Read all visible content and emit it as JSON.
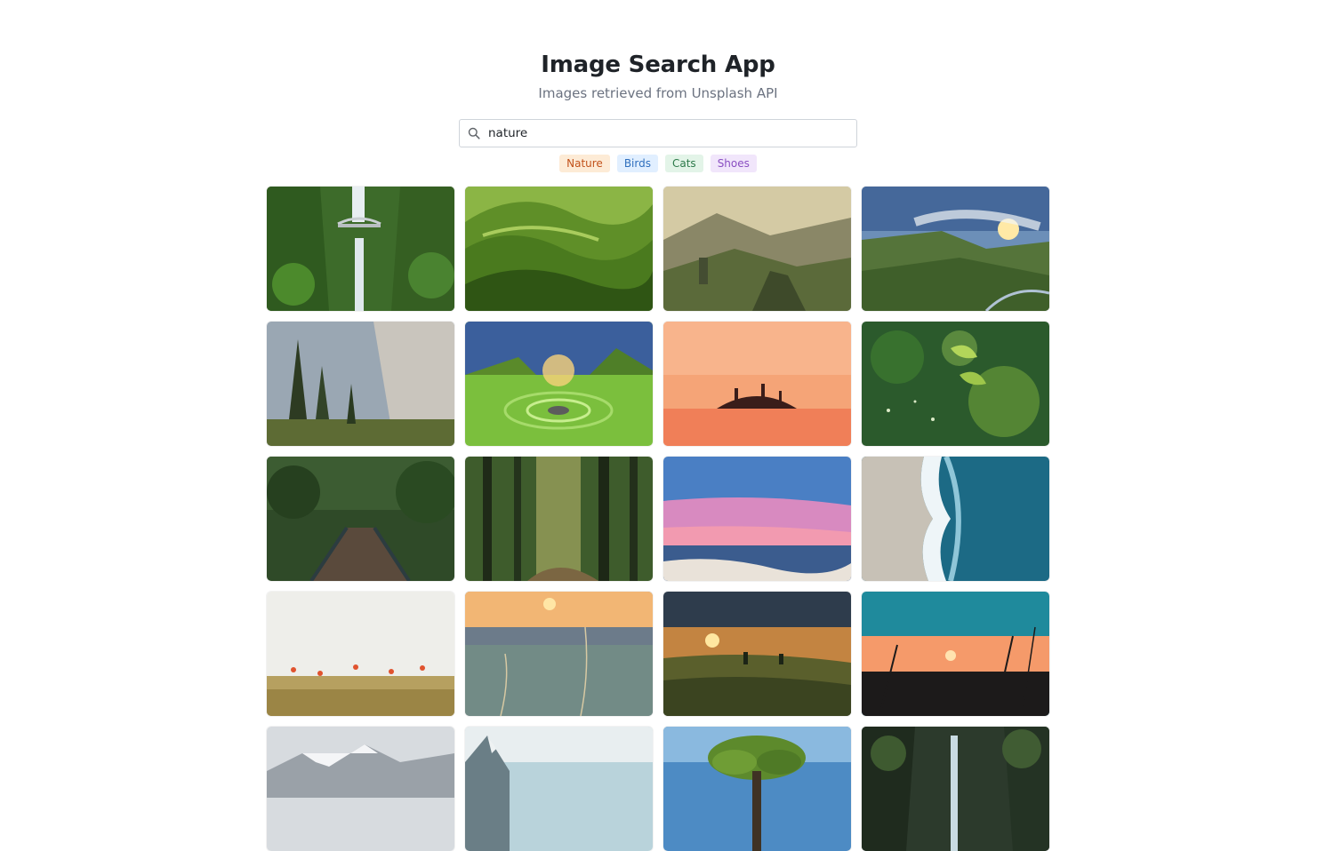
{
  "header": {
    "title": "Image Search App",
    "subtitle": "Images retrieved from Unsplash API"
  },
  "search": {
    "value": "nature",
    "icon": "search-icon"
  },
  "tags": [
    {
      "label": "Nature",
      "bg": "#fdebd6",
      "color": "#c2521b"
    },
    {
      "label": "Birds",
      "bg": "#e1efff",
      "color": "#2f6fbe"
    },
    {
      "label": "Cats",
      "bg": "#e3f4e8",
      "color": "#2d7a4a"
    },
    {
      "label": "Shoes",
      "bg": "#f1e6fb",
      "color": "#8a4fc2"
    }
  ],
  "results": [
    "waterfall-bridge",
    "green-hills",
    "misty-valley",
    "cliff-sunset",
    "granite-cliff-pines",
    "spiral-meadow",
    "sunset-island-lake",
    "leaf-bokeh",
    "forest-footbridge",
    "sunlit-forest",
    "pink-ocean-sunset",
    "aerial-wave",
    "poppy-field",
    "grass-sunrise",
    "meadow-sunrise",
    "silhouette-sunset",
    "snowy-peaks",
    "mountain-sky",
    "lone-tree",
    "forest-waterfall"
  ]
}
